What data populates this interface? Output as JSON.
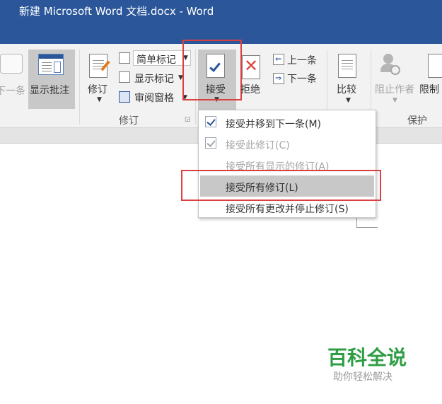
{
  "window": {
    "title": "新建 Microsoft Word 文档.docx - Word"
  },
  "ribbon": {
    "prev_change_partial": "下一条",
    "show_comments": "显示批注",
    "track_changes": "修订",
    "simple_markup": "简单标记",
    "show_markup": "显示标记",
    "review_pane": "审阅窗格",
    "group_tracking": "修订",
    "accept": "接受",
    "reject": "拒绝",
    "previous": "上一条",
    "next": "下一条",
    "compare": "比较",
    "block_authors": "阻止作者",
    "restrict_editing_partial": "限制",
    "group_protect": "保护"
  },
  "accept_menu": {
    "items": [
      {
        "label": "接受并移到下一条(M)",
        "state": "enabled",
        "checked": true
      },
      {
        "label": "接受此修订(C)",
        "state": "disabled",
        "checked": true
      },
      {
        "label": "接受所有显示的修订(A)",
        "state": "disabled",
        "checked": false
      },
      {
        "label": "接受所有修订(L)",
        "state": "highlighted",
        "checked": false
      },
      {
        "label": "接受所有更改并停止修订(S)",
        "state": "enabled",
        "checked": false
      }
    ]
  },
  "watermark": {
    "brand": "百科全说",
    "slogan": "助你轻松解决"
  },
  "colors": {
    "titlebar": "#2b579a",
    "highlight_border": "#d9413e",
    "watermark_green": "#2e9e45"
  }
}
